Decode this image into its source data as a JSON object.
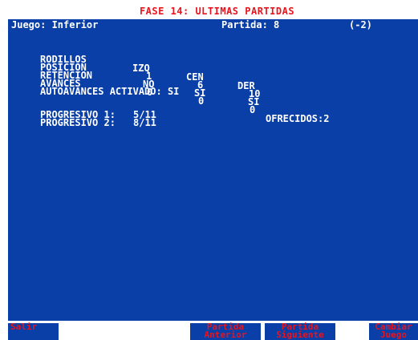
{
  "title": "FASE 14: ULTIMAS  PARTIDAS",
  "header": {
    "game": "Juego: Inferior",
    "partida": "Partida: 8",
    "delta": "(-2)"
  },
  "table": {
    "headers": [
      "RODILLOS",
      "IZQ",
      "CEN",
      "DER"
    ],
    "rows": [
      {
        "label": "POSICION",
        "izq": "1",
        "cen": "6",
        "der": "10"
      },
      {
        "label": "RETENCION",
        "izq": "NO",
        "cen": "SI",
        "der": "SI"
      },
      {
        "label": "AVANCES",
        "izq": "0",
        "cen": "0",
        "der": "0",
        "extra": "OFRECIDOS:2"
      }
    ],
    "autoavances": "AUTOAVANCES ACTIVADO: SI"
  },
  "progresivos": [
    {
      "label": "PROGRESIVO 1:",
      "value": "5/11"
    },
    {
      "label": "PROGRESIVO 2:",
      "value": "8/11"
    }
  ],
  "fkeys": {
    "salir": {
      "line1": "Salir",
      "line2": ""
    },
    "anterior": {
      "line1": "Partida",
      "line2": "Anterior"
    },
    "siguiente": {
      "line1": "Partida",
      "line2": "Siguiente"
    },
    "cambiar": {
      "line1": "Cambiar",
      "line2": "Juego"
    }
  },
  "colors": {
    "background": "#0a3fa8",
    "text": "#ffffff",
    "accent": "#e8141e"
  }
}
